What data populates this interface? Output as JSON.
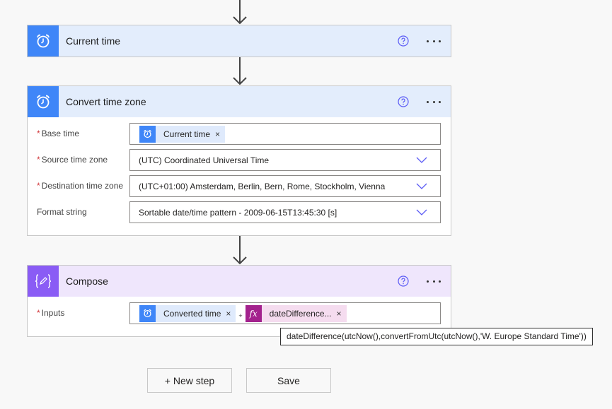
{
  "flow": {
    "steps": [
      {
        "title": "Current time",
        "icon": "alarm-clock-icon",
        "theme": "blue",
        "fields": []
      },
      {
        "title": "Convert time zone",
        "icon": "alarm-clock-icon",
        "theme": "blue",
        "fields": [
          {
            "label": "Base time",
            "required": true,
            "type": "token",
            "token": {
              "label": "Current time",
              "icon": "alarm-clock-icon"
            }
          },
          {
            "label": "Source time zone",
            "required": true,
            "type": "select",
            "value": "(UTC) Coordinated Universal Time"
          },
          {
            "label": "Destination time zone",
            "required": true,
            "type": "select",
            "value": "(UTC+01:00) Amsterdam, Berlin, Bern, Rome, Stockholm, Vienna"
          },
          {
            "label": "Format string",
            "required": false,
            "type": "select",
            "value": "Sortable date/time pattern - 2009-06-15T13:45:30 [s]"
          }
        ]
      },
      {
        "title": "Compose",
        "icon": "compose-braces-icon",
        "theme": "purple",
        "fields": [
          {
            "label": "Inputs",
            "required": true,
            "type": "tokens",
            "tokens": [
              {
                "label": "Converted time",
                "icon": "alarm-clock-icon"
              },
              {
                "label": "dateDifference...",
                "icon": "fx-icon"
              }
            ],
            "separator": "+"
          }
        ]
      }
    ]
  },
  "tooltip": {
    "text": "dateDifference(utcNow(),convertFromUtc(utcNow(),'W. Europe Standard Time'))"
  },
  "actions": {
    "new_step_label": "+ New step",
    "save_label": "Save"
  },
  "symbols": {
    "required_mark": "*",
    "remove_mark": "×",
    "fx_label": "fx"
  },
  "colors": {
    "action_blue": "#3f86f8",
    "header_blue": "#e3edfc",
    "compose_purple": "#8a5cf5",
    "header_purple": "#efe6fc",
    "expression_magenta": "#a3228d",
    "required_red": "#d13438",
    "accent_icon": "#5c5cf5"
  }
}
